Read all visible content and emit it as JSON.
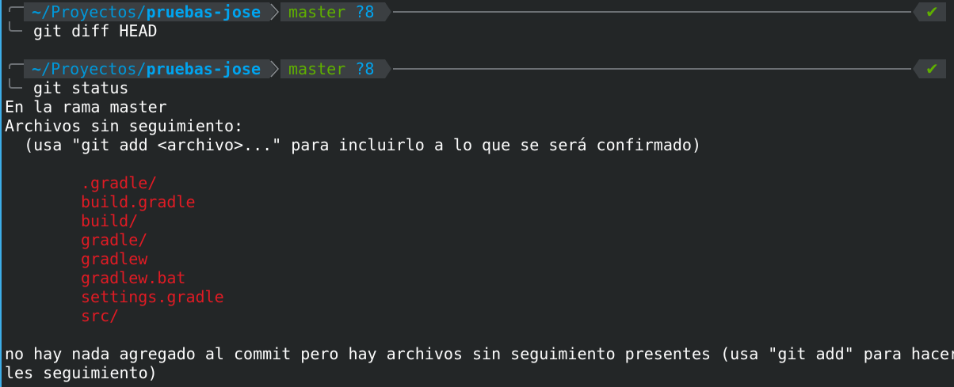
{
  "prompts": [
    {
      "path_home": "~",
      "path_mid": "/Proyectos/",
      "path_dir": "pruebas-jose",
      "branch": "master",
      "git_status": "?8",
      "command": "git diff HEAD",
      "status_icon": "check-icon"
    },
    {
      "path_home": "~",
      "path_mid": "/Proyectos/",
      "path_dir": "pruebas-jose",
      "branch": "master",
      "git_status": "?8",
      "command": "git status",
      "status_icon": "check-icon"
    }
  ],
  "check_glyph": "✔",
  "output": {
    "branch_line": "En la rama master",
    "untracked_header": "Archivos sin seguimiento:",
    "hint": "  (usa \"git add <archivo>...\" para incluirlo a lo que se será confirmado)",
    "files": [
      ".gradle/",
      "build.gradle",
      "build/",
      "gradle/",
      "gradlew",
      "gradlew.bat",
      "settings.gradle",
      "src/"
    ],
    "summary_1": "no hay nada agregado al commit pero hay archivos sin seguimiento presentes (usa \"git add\" para hacer",
    "summary_2": "les seguimiento)"
  },
  "colors": {
    "background": "#232627",
    "segment_bg": "#3b3f42",
    "path": "#0097d8",
    "branch": "#5faf00",
    "untracked": "#e01b24",
    "foreground": "#fcfcfc"
  }
}
